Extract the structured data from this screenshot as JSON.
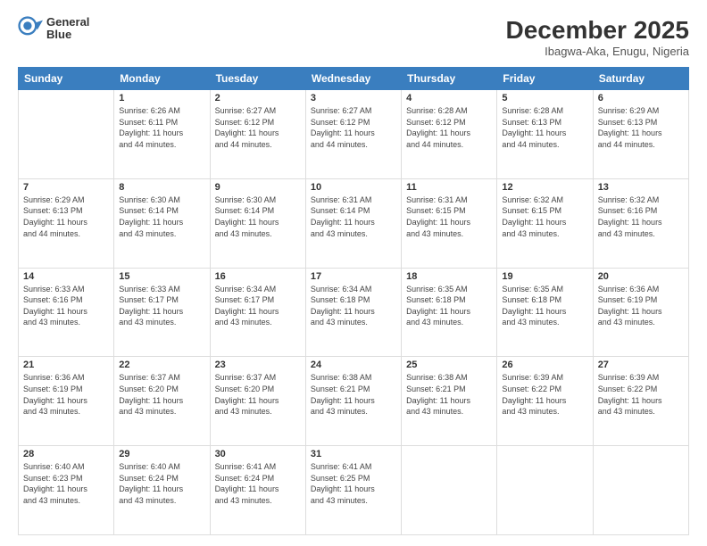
{
  "header": {
    "logo_line1": "General",
    "logo_line2": "Blue",
    "month_title": "December 2025",
    "location": "Ibagwa-Aka, Enugu, Nigeria"
  },
  "days_of_week": [
    "Sunday",
    "Monday",
    "Tuesday",
    "Wednesday",
    "Thursday",
    "Friday",
    "Saturday"
  ],
  "weeks": [
    [
      {
        "day": "",
        "info": ""
      },
      {
        "day": "1",
        "info": "Sunrise: 6:26 AM\nSunset: 6:11 PM\nDaylight: 11 hours\nand 44 minutes."
      },
      {
        "day": "2",
        "info": "Sunrise: 6:27 AM\nSunset: 6:12 PM\nDaylight: 11 hours\nand 44 minutes."
      },
      {
        "day": "3",
        "info": "Sunrise: 6:27 AM\nSunset: 6:12 PM\nDaylight: 11 hours\nand 44 minutes."
      },
      {
        "day": "4",
        "info": "Sunrise: 6:28 AM\nSunset: 6:12 PM\nDaylight: 11 hours\nand 44 minutes."
      },
      {
        "day": "5",
        "info": "Sunrise: 6:28 AM\nSunset: 6:13 PM\nDaylight: 11 hours\nand 44 minutes."
      },
      {
        "day": "6",
        "info": "Sunrise: 6:29 AM\nSunset: 6:13 PM\nDaylight: 11 hours\nand 44 minutes."
      }
    ],
    [
      {
        "day": "7",
        "info": "Sunrise: 6:29 AM\nSunset: 6:13 PM\nDaylight: 11 hours\nand 44 minutes."
      },
      {
        "day": "8",
        "info": "Sunrise: 6:30 AM\nSunset: 6:14 PM\nDaylight: 11 hours\nand 43 minutes."
      },
      {
        "day": "9",
        "info": "Sunrise: 6:30 AM\nSunset: 6:14 PM\nDaylight: 11 hours\nand 43 minutes."
      },
      {
        "day": "10",
        "info": "Sunrise: 6:31 AM\nSunset: 6:14 PM\nDaylight: 11 hours\nand 43 minutes."
      },
      {
        "day": "11",
        "info": "Sunrise: 6:31 AM\nSunset: 6:15 PM\nDaylight: 11 hours\nand 43 minutes."
      },
      {
        "day": "12",
        "info": "Sunrise: 6:32 AM\nSunset: 6:15 PM\nDaylight: 11 hours\nand 43 minutes."
      },
      {
        "day": "13",
        "info": "Sunrise: 6:32 AM\nSunset: 6:16 PM\nDaylight: 11 hours\nand 43 minutes."
      }
    ],
    [
      {
        "day": "14",
        "info": "Sunrise: 6:33 AM\nSunset: 6:16 PM\nDaylight: 11 hours\nand 43 minutes."
      },
      {
        "day": "15",
        "info": "Sunrise: 6:33 AM\nSunset: 6:17 PM\nDaylight: 11 hours\nand 43 minutes."
      },
      {
        "day": "16",
        "info": "Sunrise: 6:34 AM\nSunset: 6:17 PM\nDaylight: 11 hours\nand 43 minutes."
      },
      {
        "day": "17",
        "info": "Sunrise: 6:34 AM\nSunset: 6:18 PM\nDaylight: 11 hours\nand 43 minutes."
      },
      {
        "day": "18",
        "info": "Sunrise: 6:35 AM\nSunset: 6:18 PM\nDaylight: 11 hours\nand 43 minutes."
      },
      {
        "day": "19",
        "info": "Sunrise: 6:35 AM\nSunset: 6:18 PM\nDaylight: 11 hours\nand 43 minutes."
      },
      {
        "day": "20",
        "info": "Sunrise: 6:36 AM\nSunset: 6:19 PM\nDaylight: 11 hours\nand 43 minutes."
      }
    ],
    [
      {
        "day": "21",
        "info": "Sunrise: 6:36 AM\nSunset: 6:19 PM\nDaylight: 11 hours\nand 43 minutes."
      },
      {
        "day": "22",
        "info": "Sunrise: 6:37 AM\nSunset: 6:20 PM\nDaylight: 11 hours\nand 43 minutes."
      },
      {
        "day": "23",
        "info": "Sunrise: 6:37 AM\nSunset: 6:20 PM\nDaylight: 11 hours\nand 43 minutes."
      },
      {
        "day": "24",
        "info": "Sunrise: 6:38 AM\nSunset: 6:21 PM\nDaylight: 11 hours\nand 43 minutes."
      },
      {
        "day": "25",
        "info": "Sunrise: 6:38 AM\nSunset: 6:21 PM\nDaylight: 11 hours\nand 43 minutes."
      },
      {
        "day": "26",
        "info": "Sunrise: 6:39 AM\nSunset: 6:22 PM\nDaylight: 11 hours\nand 43 minutes."
      },
      {
        "day": "27",
        "info": "Sunrise: 6:39 AM\nSunset: 6:22 PM\nDaylight: 11 hours\nand 43 minutes."
      }
    ],
    [
      {
        "day": "28",
        "info": "Sunrise: 6:40 AM\nSunset: 6:23 PM\nDaylight: 11 hours\nand 43 minutes."
      },
      {
        "day": "29",
        "info": "Sunrise: 6:40 AM\nSunset: 6:24 PM\nDaylight: 11 hours\nand 43 minutes."
      },
      {
        "day": "30",
        "info": "Sunrise: 6:41 AM\nSunset: 6:24 PM\nDaylight: 11 hours\nand 43 minutes."
      },
      {
        "day": "31",
        "info": "Sunrise: 6:41 AM\nSunset: 6:25 PM\nDaylight: 11 hours\nand 43 minutes."
      },
      {
        "day": "",
        "info": ""
      },
      {
        "day": "",
        "info": ""
      },
      {
        "day": "",
        "info": ""
      }
    ]
  ]
}
